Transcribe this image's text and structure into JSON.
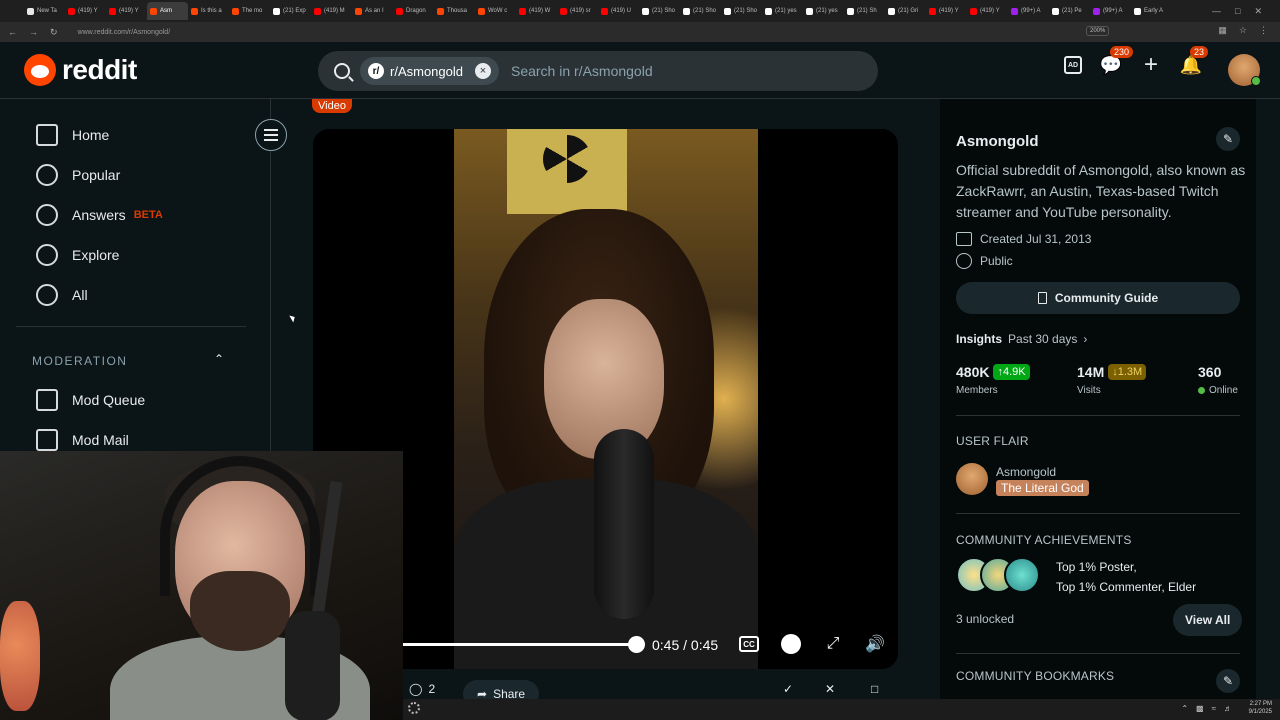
{
  "browser": {
    "tabs": [
      {
        "title": "New Ta",
        "color": "#e8e8e8",
        "active": false
      },
      {
        "title": "(419) Y",
        "color": "#ff0000",
        "active": false
      },
      {
        "title": "(419) Y",
        "color": "#ff0000",
        "active": false
      },
      {
        "title": "Asm",
        "color": "#ff4500",
        "active": true
      },
      {
        "title": "Is this a",
        "color": "#ff4500",
        "active": false
      },
      {
        "title": "The mo",
        "color": "#ff4500",
        "active": false
      },
      {
        "title": "(21) Exp",
        "color": "#ffffff",
        "active": false
      },
      {
        "title": "(419) M",
        "color": "#ff0000",
        "active": false
      },
      {
        "title": "As an I",
        "color": "#ff4500",
        "active": false
      },
      {
        "title": "Dragon",
        "color": "#ff0000",
        "active": false
      },
      {
        "title": "Thousa",
        "color": "#ff4500",
        "active": false
      },
      {
        "title": "WoW c",
        "color": "#ff4500",
        "active": false
      },
      {
        "title": "(419) W",
        "color": "#ff0000",
        "active": false
      },
      {
        "title": "(419) sr",
        "color": "#ff0000",
        "active": false
      },
      {
        "title": "(419) U",
        "color": "#ff0000",
        "active": false
      },
      {
        "title": "(21) Sho",
        "color": "#ffffff",
        "active": false
      },
      {
        "title": "(21) Sho",
        "color": "#ffffff",
        "active": false
      },
      {
        "title": "(21) Sho",
        "color": "#ffffff",
        "active": false
      },
      {
        "title": "(21) yes",
        "color": "#ffffff",
        "active": false
      },
      {
        "title": "(21) yes",
        "color": "#ffffff",
        "active": false
      },
      {
        "title": "(21) Sh",
        "color": "#ffffff",
        "active": false
      },
      {
        "title": "(21) Gri",
        "color": "#ffffff",
        "active": false
      },
      {
        "title": "(419) Y",
        "color": "#ff0000",
        "active": false
      },
      {
        "title": "(419) Y",
        "color": "#ff0000",
        "active": false
      },
      {
        "title": "(99+) A",
        "color": "#a020f0",
        "active": false
      },
      {
        "title": "(21) Pe",
        "color": "#ffffff",
        "active": false
      },
      {
        "title": "(99+) A",
        "color": "#a020f0",
        "active": false
      },
      {
        "title": "Early A",
        "color": "#ffffff",
        "active": false
      }
    ],
    "url": "www.reddit.com/r/Asmongold/",
    "zoom": "200%"
  },
  "header": {
    "logo_text": "reddit",
    "search": {
      "chip_label": "r/Asmongold",
      "chip_icon": "r/",
      "placeholder": "Search in r/Asmongold"
    },
    "chat_badge": "230",
    "notif_badge": "23"
  },
  "sidebar": {
    "items": [
      {
        "label": "Home"
      },
      {
        "label": "Popular"
      },
      {
        "label": "Answers",
        "badge": "BETA"
      },
      {
        "label": "Explore"
      },
      {
        "label": "All"
      }
    ],
    "moderation_label": "MODERATION",
    "mod_items": [
      {
        "label": "Mod Queue"
      },
      {
        "label": "Mod Mail"
      }
    ]
  },
  "post": {
    "flair": "Video",
    "time": "0:45 / 0:45",
    "progress_fraction": 1.0,
    "cc_label": "CC",
    "comments": "2",
    "share_label": "Share"
  },
  "community": {
    "name": "Asmongold",
    "description": "Official subreddit of Asmongold, also known as ZackRawrr, an Austin, Texas-based Twitch streamer and YouTube personality.",
    "created": "Created Jul 31, 2013",
    "visibility": "Public",
    "guide_label": "Community Guide",
    "insights_label": "Insights",
    "insights_period": "Past 30 days",
    "stats": [
      {
        "value": "480K",
        "change": "4.9K",
        "direction": "up",
        "label": "Members",
        "change_bg": "#01a816"
      },
      {
        "value": "14M",
        "change": "1.3M",
        "direction": "down",
        "label": "Visits",
        "change_bg": "#7a6000"
      },
      {
        "value": "360",
        "change": "",
        "direction": "",
        "label": "Online",
        "change_bg": ""
      }
    ],
    "user_flair_heading": "USER FLAIR",
    "flair_user": "Asmongold",
    "flair_tag": "The Literal God",
    "achievements_heading": "COMMUNITY ACHIEVEMENTS",
    "achievements_line1": "Top 1% Poster,",
    "achievements_line2": "Top 1% Commenter, Elder",
    "unlocked": "3 unlocked",
    "view_all": "View All",
    "bookmarks_heading": "COMMUNITY BOOKMARKS"
  },
  "taskbar": {
    "time": "2:27 PM",
    "date": "9/1/2025"
  }
}
